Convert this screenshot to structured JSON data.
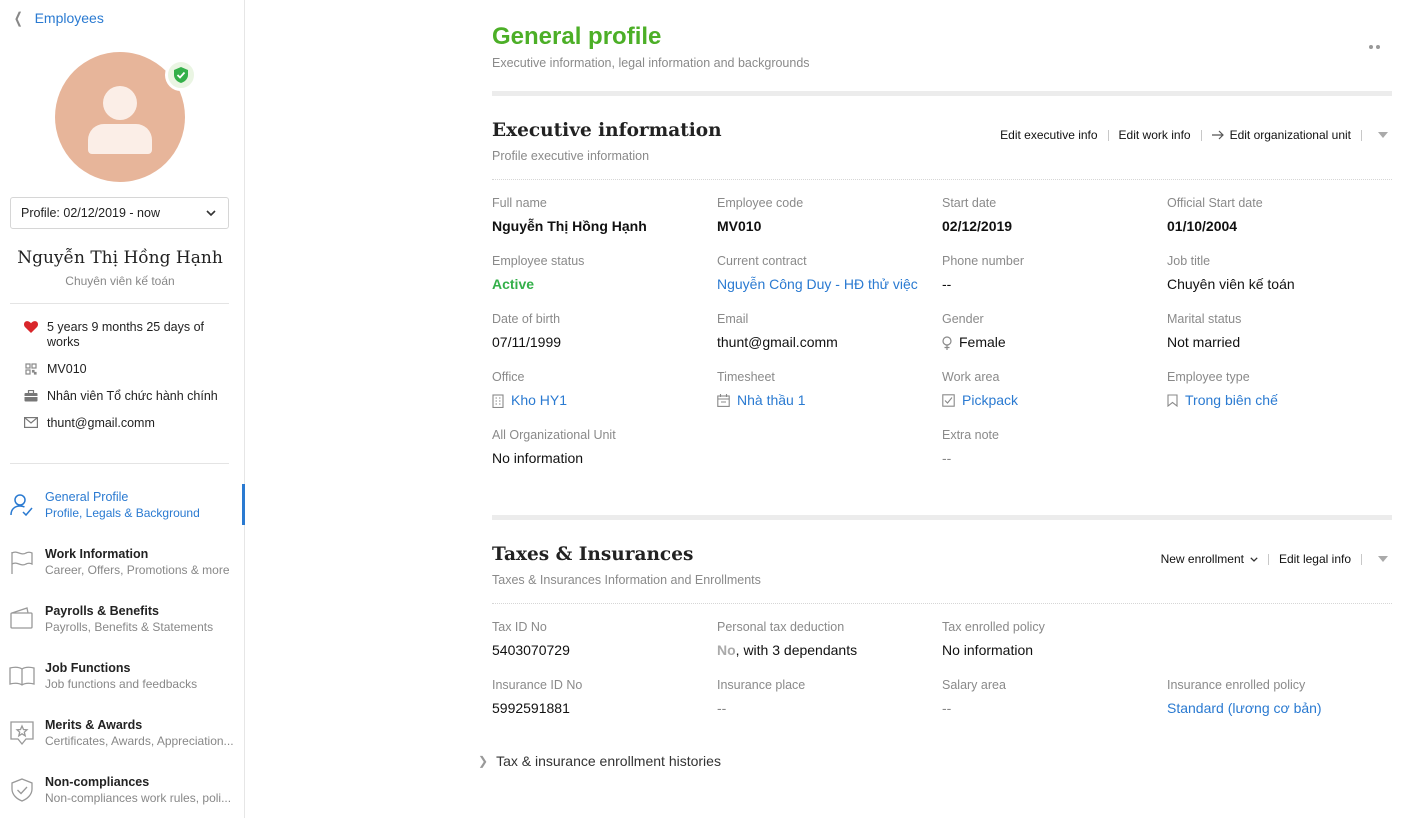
{
  "sidebar": {
    "back_label": "Employees",
    "profile_period": "Profile: 02/12/2019 - now",
    "name": "Nguyễn Thị Hồng Hạnh",
    "role": "Chuyên viên kế toán",
    "info": {
      "tenure": "5 years 9 months 25 days of works",
      "code": "MV010",
      "department": "Nhân viên Tổ chức hành chính",
      "email": "thunt@gmail.comm"
    },
    "nav": [
      {
        "title": "General Profile",
        "subtitle": "Profile, Legals & Background",
        "icon": "user-check-icon"
      },
      {
        "title": "Work Information",
        "subtitle": "Career, Offers, Promotions & more",
        "icon": "flag-icon"
      },
      {
        "title": "Payrolls & Benefits",
        "subtitle": "Payrolls, Benefits & Statements",
        "icon": "wallet-icon"
      },
      {
        "title": "Job Functions",
        "subtitle": "Job functions and feedbacks",
        "icon": "book-icon"
      },
      {
        "title": "Merits & Awards",
        "subtitle": "Certificates, Awards, Appreciation...",
        "icon": "star-badge-icon"
      },
      {
        "title": "Non-compliances",
        "subtitle": "Non-compliances work rules, poli...",
        "icon": "shield-check-icon"
      }
    ]
  },
  "page": {
    "title": "General profile",
    "subtitle": "Executive information, legal information and backgrounds",
    "more_icon": "ellipsis-icon"
  },
  "executive": {
    "title": "Executive information",
    "subtitle": "Profile executive information",
    "actions": {
      "edit_exec": "Edit executive info",
      "edit_work": "Edit work info",
      "edit_org": "Edit organizational unit"
    },
    "fields": {
      "full_name": {
        "label": "Full name",
        "value": "Nguyễn Thị Hồng Hạnh"
      },
      "employee_code": {
        "label": "Employee code",
        "value": "MV010"
      },
      "start_date": {
        "label": "Start date",
        "value": "02/12/2019"
      },
      "official_start": {
        "label": "Official Start date",
        "value": "01/10/2004"
      },
      "status": {
        "label": "Employee status",
        "value": "Active"
      },
      "contract": {
        "label": "Current contract",
        "value": "Nguyễn Công Duy - HĐ thử việc"
      },
      "phone": {
        "label": "Phone number",
        "value": "--"
      },
      "job_title": {
        "label": "Job title",
        "value": "Chuyên viên kế toán"
      },
      "dob": {
        "label": "Date of birth",
        "value": "07/11/1999"
      },
      "email": {
        "label": "Email",
        "value": "thunt@gmail.comm"
      },
      "gender": {
        "label": "Gender",
        "value": "Female"
      },
      "marital": {
        "label": "Marital status",
        "value": "Not married"
      },
      "office": {
        "label": "Office",
        "value": "Kho HY1"
      },
      "timesheet": {
        "label": "Timesheet",
        "value": "Nhà thầu 1"
      },
      "work_area": {
        "label": "Work area",
        "value": "Pickpack"
      },
      "employee_type": {
        "label": "Employee type",
        "value": "Trong biên chế"
      },
      "org_unit": {
        "label": "All Organizational Unit",
        "value": "No information"
      },
      "extra_note": {
        "label": "Extra note",
        "value": "--"
      }
    }
  },
  "taxes": {
    "title": "Taxes & Insurances",
    "subtitle": "Taxes & Insurances Information and Enrollments",
    "actions": {
      "new_enrollment": "New enrollment",
      "edit_legal": "Edit legal info"
    },
    "fields": {
      "tax_id": {
        "label": "Tax ID No",
        "value": "5403070729"
      },
      "deduction": {
        "label": "Personal tax deduction",
        "value_no": "No",
        "value_rest": ", with 3 dependants"
      },
      "tax_policy": {
        "label": "Tax enrolled policy",
        "value": "No information"
      },
      "insurance_id": {
        "label": "Insurance ID No",
        "value": "5992591881"
      },
      "insurance_place": {
        "label": "Insurance place",
        "value": "--"
      },
      "salary_area": {
        "label": "Salary area",
        "value": "--"
      },
      "insurance_policy": {
        "label": "Insurance enrolled policy",
        "value": "Standard (lương cơ bản)"
      }
    },
    "history_label": "Tax & insurance enrollment histories"
  },
  "colors": {
    "accent": "#2a7ad1",
    "title_green": "#4caf27",
    "active_green": "#34b04a",
    "avatar": "#e7b59a",
    "heart": "#d9262b"
  }
}
